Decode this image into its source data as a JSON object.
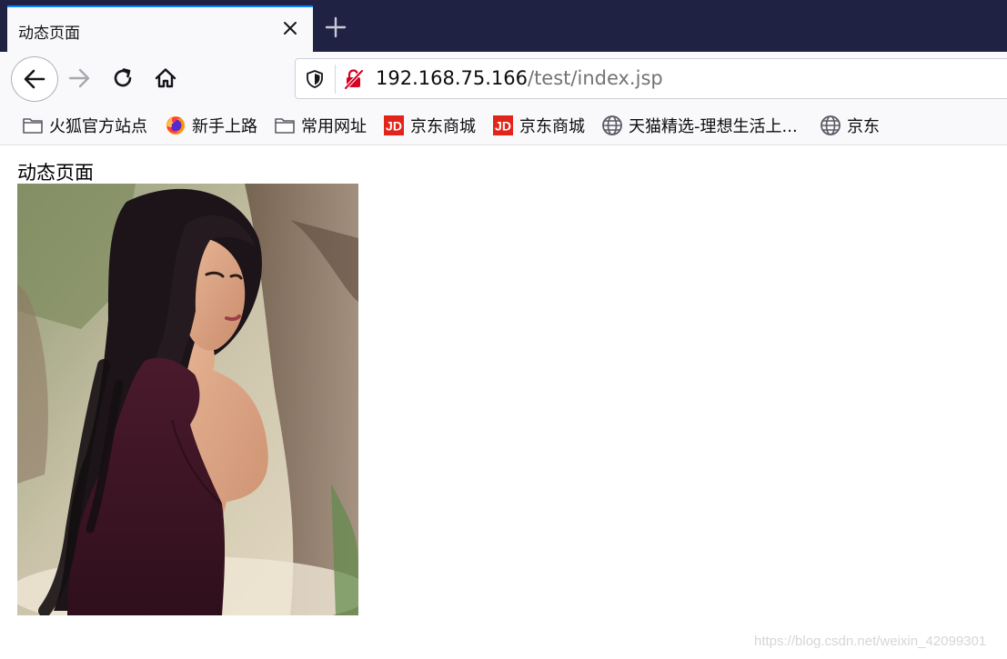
{
  "browser": {
    "tab": {
      "title": "动态页面"
    },
    "url": {
      "host": "192.168.75.166",
      "path": "/test/index.jsp"
    },
    "accent": "#0a84ff",
    "tabstrip_color": "#1f2243"
  },
  "bookmarks": [
    {
      "label": "火狐官方站点",
      "icon": "folder-icon"
    },
    {
      "label": "新手上路",
      "icon": "firefox-icon"
    },
    {
      "label": "常用网址",
      "icon": "folder-icon"
    },
    {
      "label": "京东商城",
      "icon": "jd-icon"
    },
    {
      "label": "京东商城",
      "icon": "jd-icon"
    },
    {
      "label": "天猫精选-理想生活上...",
      "icon": "globe-icon"
    },
    {
      "label": "京东",
      "icon": "globe-icon"
    }
  ],
  "page": {
    "heading": "动态页面",
    "image": "portrait photo of a woman with long dark hair in a burgundy sleeveless top"
  },
  "watermark": "https://blog.csdn.net/weixin_42099301"
}
